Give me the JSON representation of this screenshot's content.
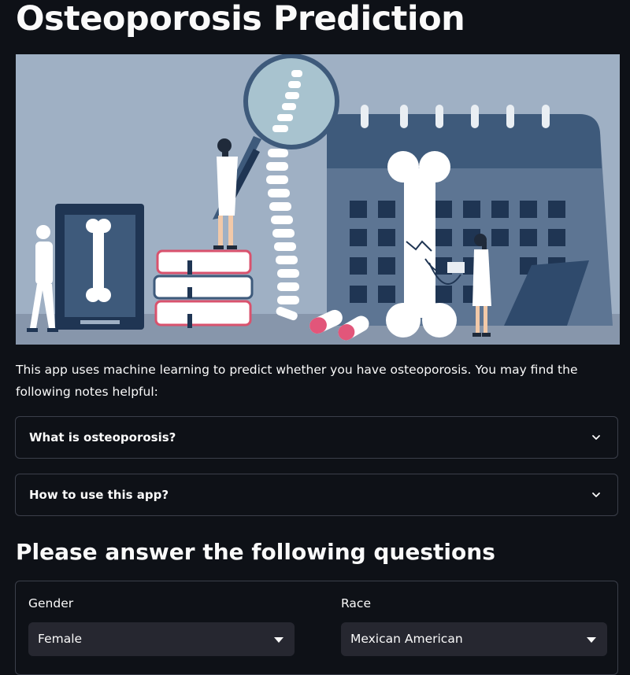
{
  "page": {
    "title": "Osteoporosis Prediction",
    "hero_image": "osteoporosis-illustration",
    "intro": "This app uses machine learning to predict whether you have osteoporosis. You may find the following notes helpful:"
  },
  "expanders": [
    {
      "label": "What is osteoporosis?",
      "icon": "chevron-down-icon"
    },
    {
      "label": "How to use this app?",
      "icon": "chevron-down-icon"
    }
  ],
  "questions": {
    "heading": "Please answer the following questions",
    "gender": {
      "label": "Gender",
      "value": "Female"
    },
    "race": {
      "label": "Race",
      "value": "Mexican American"
    }
  },
  "colors": {
    "background": "#0e1117",
    "text": "#fafafa",
    "border": "#3b3f4a",
    "select_bg": "#262730",
    "illustration_bg": "#9fb0c4"
  }
}
